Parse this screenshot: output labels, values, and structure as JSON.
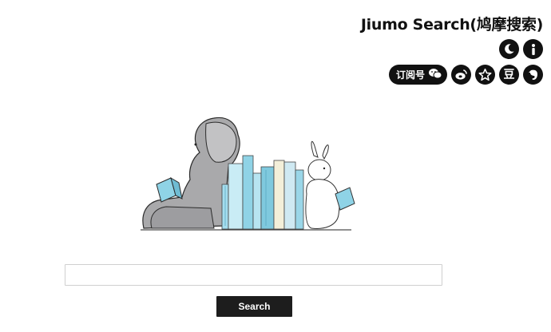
{
  "header": {
    "brand": "Jiumo Search(鸠摩搜索)"
  },
  "toolbar": {
    "subscribe_label": "订阅号",
    "icons": [
      "moon-icon",
      "info-icon",
      "wechat-icon",
      "weibo-icon",
      "star-icon",
      "douban-icon",
      "evernote-icon"
    ],
    "douban_glyph": "豆"
  },
  "search": {
    "value": "",
    "placeholder": "",
    "button_label": "Search"
  },
  "colors": {
    "icon_bg": "#111111",
    "button_bg": "#1d1d1d",
    "book_blue": "#8fd3e6",
    "book_cream": "#f3efd9",
    "elephant_gray": "#a9a9ab"
  }
}
